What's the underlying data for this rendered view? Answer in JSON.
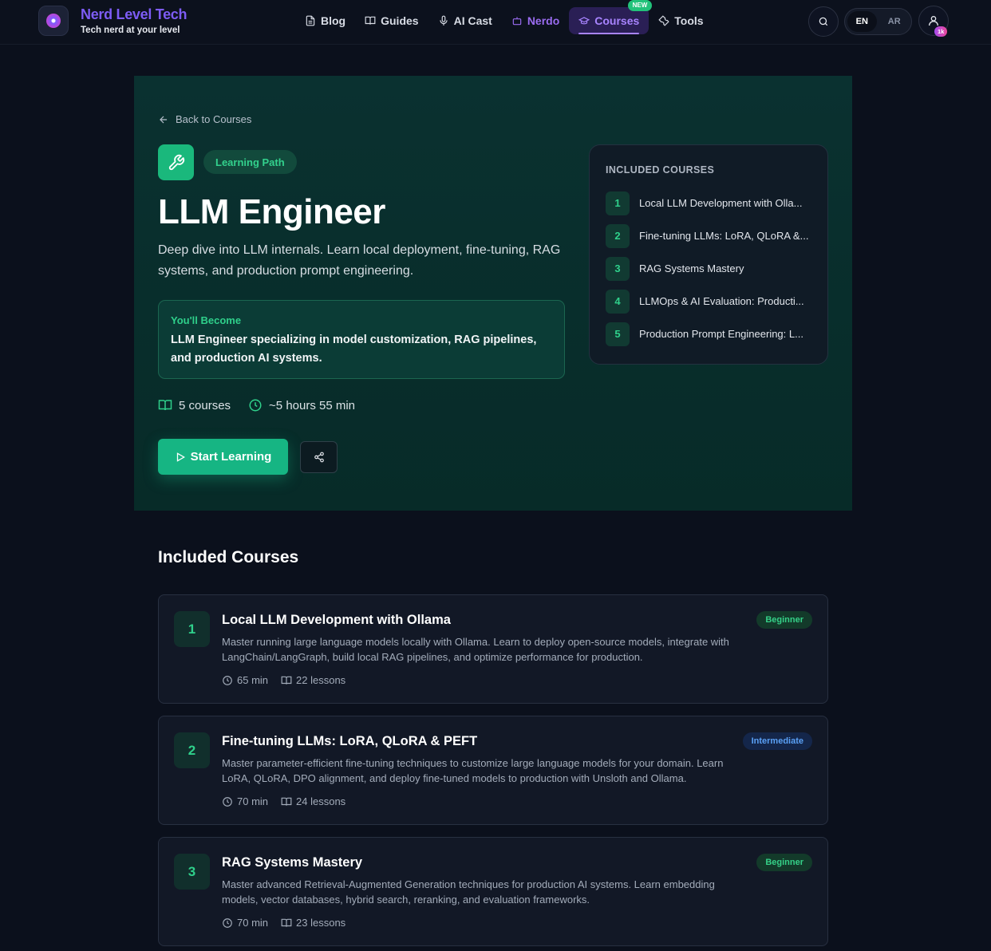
{
  "nav": {
    "brand_name": "Nerd Level Tech",
    "brand_tagline": "Tech nerd at your level",
    "links": [
      {
        "label": "Blog",
        "icon": "document-icon"
      },
      {
        "label": "Guides",
        "icon": "book-icon"
      },
      {
        "label": "AI Cast",
        "icon": "microphone-icon"
      },
      {
        "label": "Nerdo",
        "icon": "robot-icon"
      },
      {
        "label": "Courses",
        "icon": "graduation-cap-icon",
        "active": true,
        "badge": "NEW"
      },
      {
        "label": "Tools",
        "icon": "wrench-icon"
      }
    ],
    "lang": {
      "en": "EN",
      "ar": "AR",
      "selected": "EN"
    },
    "user_badge": "1k"
  },
  "hero": {
    "back_label": "Back to Courses",
    "chip": "Learning Path",
    "title": "LLM Engineer",
    "description": "Deep dive into LLM internals. Learn local deployment, fine-tuning, RAG systems, and production prompt engineering.",
    "become_label": "You'll Become",
    "become_text": "LLM Engineer specializing in model customization, RAG pipelines, and production AI systems.",
    "courses_count": "5 courses",
    "duration": "~5 hours 55 min",
    "start_label": "Start Learning"
  },
  "sidebar": {
    "title": "INCLUDED COURSES",
    "items": [
      {
        "num": "1",
        "label": "Local LLM Development with Olla..."
      },
      {
        "num": "2",
        "label": "Fine-tuning LLMs: LoRA, QLoRA &..."
      },
      {
        "num": "3",
        "label": "RAG Systems Mastery"
      },
      {
        "num": "4",
        "label": "LLMOps & AI Evaluation: Producti..."
      },
      {
        "num": "5",
        "label": "Production Prompt Engineering: L..."
      }
    ]
  },
  "section_title": "Included Courses",
  "courses": [
    {
      "num": "1",
      "title": "Local LLM Development with Ollama",
      "description": "Master running large language models locally with Ollama. Learn to deploy open-source models, integrate with LangChain/LangGraph, build local RAG pipelines, and optimize performance for production.",
      "duration": "65 min",
      "lessons": "22 lessons",
      "level": "Beginner"
    },
    {
      "num": "2",
      "title": "Fine-tuning LLMs: LoRA, QLoRA & PEFT",
      "description": "Master parameter-efficient fine-tuning techniques to customize large language models for your domain. Learn LoRA, QLoRA, DPO alignment, and deploy fine-tuned models to production with Unsloth and Ollama.",
      "duration": "70 min",
      "lessons": "24 lessons",
      "level": "Intermediate"
    },
    {
      "num": "3",
      "title": "RAG Systems Mastery",
      "description": "Master advanced Retrieval-Augmented Generation techniques for production AI systems. Learn embedding models, vector databases, hybrid search, reranking, and evaluation frameworks.",
      "duration": "70 min",
      "lessons": "23 lessons",
      "level": "Beginner"
    }
  ],
  "colors": {
    "accent_green": "#16b583",
    "brand_purple": "#7d5cf5",
    "hero_bg": "#0a3130",
    "page_bg": "#0b101c"
  }
}
